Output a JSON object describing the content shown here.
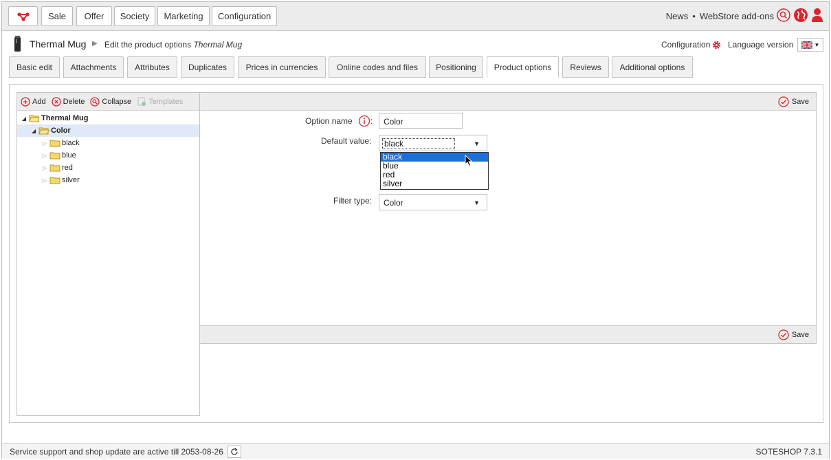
{
  "nav": {
    "items": [
      "Sale",
      "Offer",
      "Society",
      "Marketing",
      "Configuration"
    ],
    "news": "News",
    "separator": "•",
    "addons": "WebStore add-ons"
  },
  "titlebar": {
    "product": "Thermal Mug",
    "breadcrumb_prefix": "Edit the product options",
    "breadcrumb_product": "Thermal Mug",
    "configuration": "Configuration",
    "language_version": "Language version"
  },
  "tabs": [
    "Basic edit",
    "Attachments",
    "Attributes",
    "Duplicates",
    "Prices in currencies",
    "Online codes and files",
    "Positioning",
    "Product options",
    "Reviews",
    "Additional options"
  ],
  "tree_toolbar": {
    "add": "Add",
    "delete": "Delete",
    "collapse": "Collapse",
    "templates": "Templates"
  },
  "tree": {
    "root": "Thermal Mug",
    "group": "Color",
    "items": [
      "black",
      "blue",
      "red",
      "silver"
    ]
  },
  "form": {
    "save": "Save",
    "option_name_label": "Option name",
    "option_name_value": "Color",
    "default_value_label": "Default value:",
    "default_value_selected": "black",
    "default_value_options": [
      "black",
      "blue",
      "red",
      "silver"
    ],
    "filter_type_label": "Filter type:",
    "filter_type_value": "Color"
  },
  "footer": {
    "status": "Service support and shop update are active till 2053-08-26",
    "version": "SOTESHOP 7.3.1"
  },
  "colors": {
    "accent_red": "#d9262e",
    "highlight_blue": "#1e6fd9",
    "folder_yellow": "#f5d86a"
  }
}
